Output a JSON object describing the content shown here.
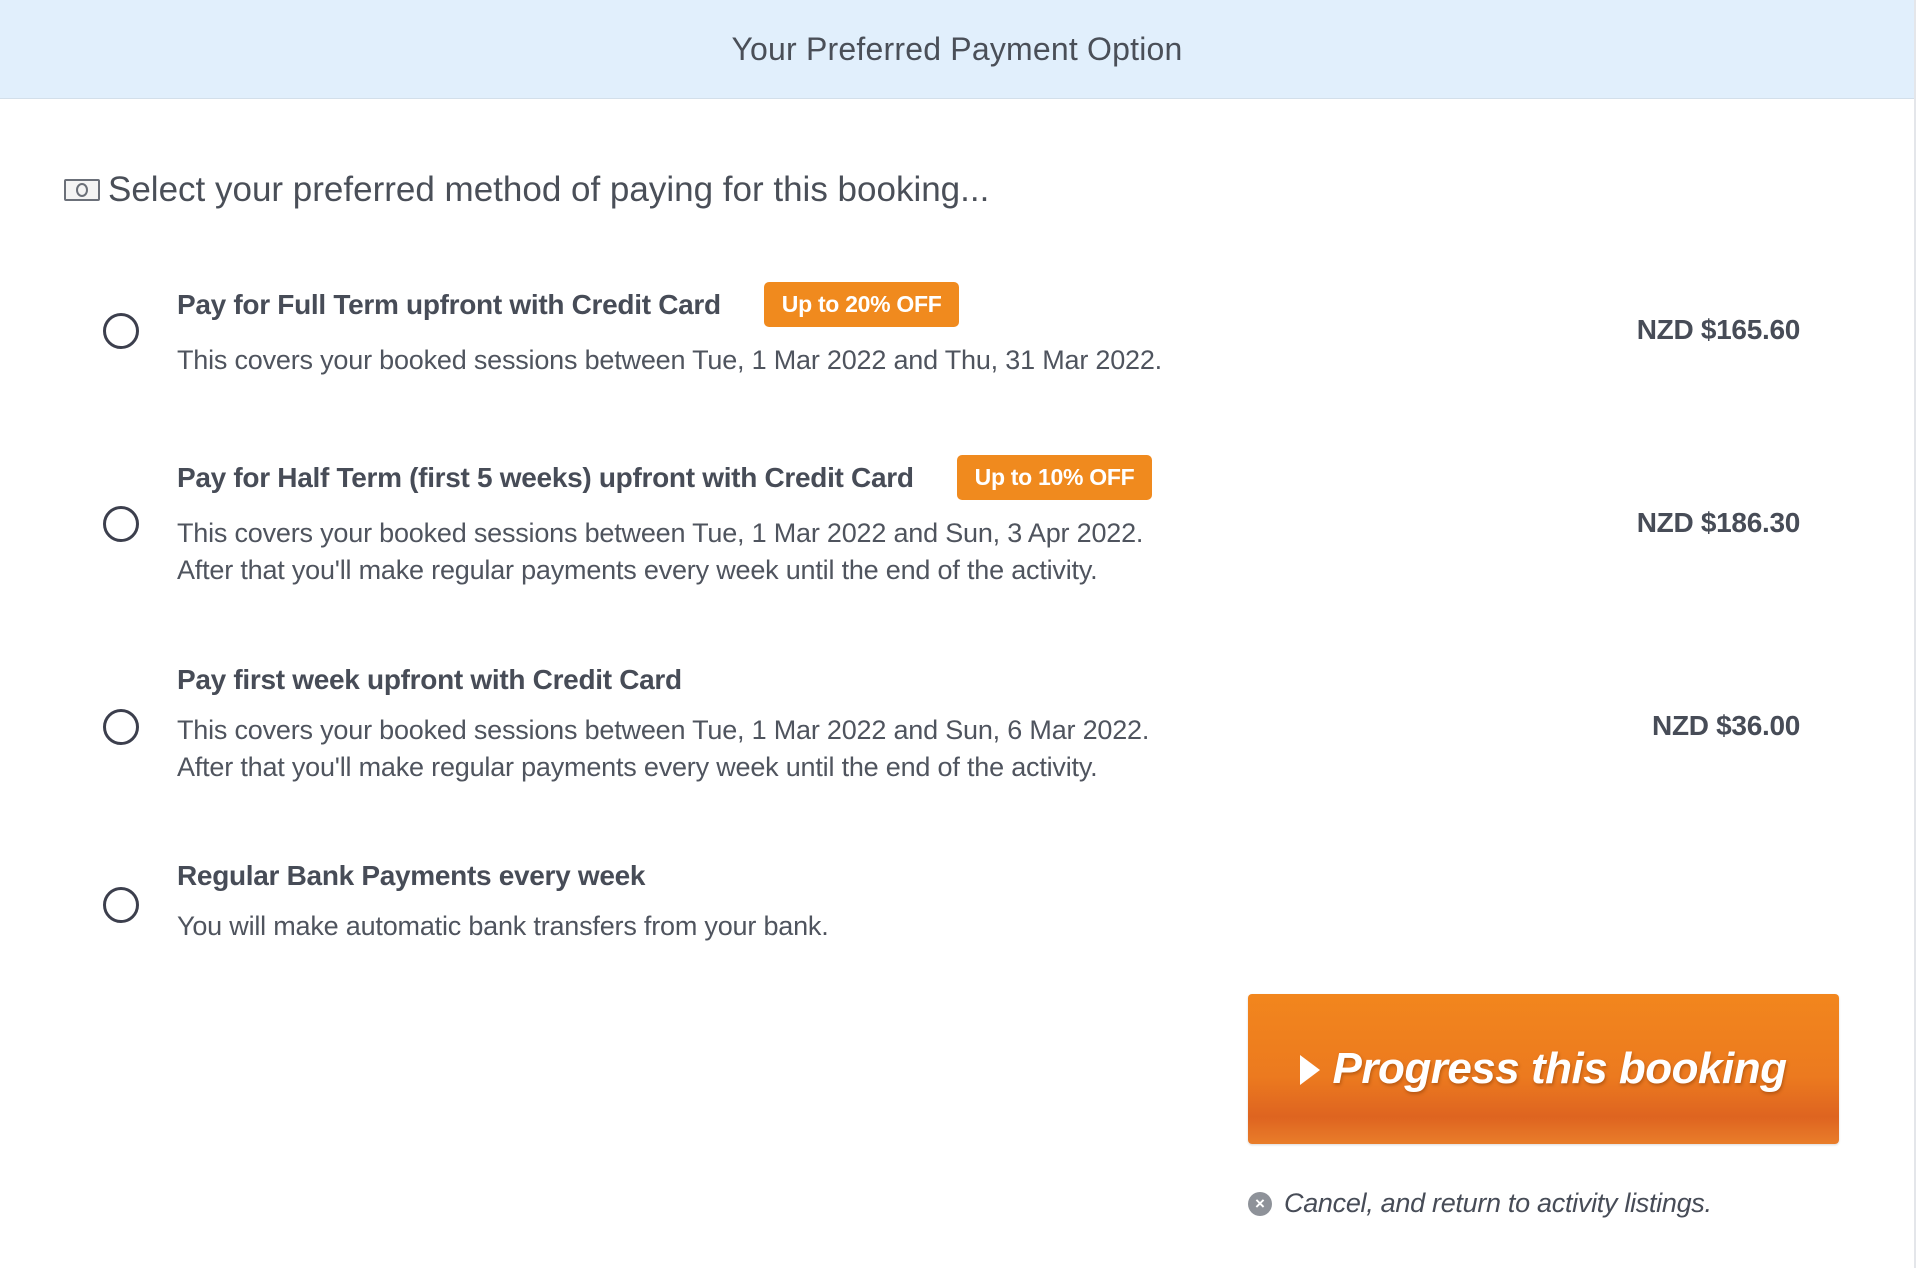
{
  "header": {
    "title": "Your Preferred Payment Option"
  },
  "intro": {
    "icon": "money-icon",
    "text": "Select your preferred method of paying for this booking..."
  },
  "options": [
    {
      "title": "Pay for Full Term upfront with Credit Card",
      "badge": "Up to 20% OFF",
      "desc_line1": "This covers your booked sessions between Tue, 1 Mar 2022 and Thu, 31 Mar 2022.",
      "desc_line2": "",
      "price": "NZD $165.60",
      "selected": false
    },
    {
      "title": "Pay for Half Term (first 5 weeks) upfront with Credit Card",
      "badge": "Up to 10% OFF",
      "desc_line1": "This covers your booked sessions between Tue, 1 Mar 2022 and Sun, 3 Apr 2022.",
      "desc_line2": "After that you'll make regular payments every week until the end of the activity.",
      "price": "NZD $186.30",
      "selected": false
    },
    {
      "title": "Pay first week upfront with Credit Card",
      "badge": "",
      "desc_line1": "This covers your booked sessions between Tue, 1 Mar 2022 and Sun, 6 Mar 2022.",
      "desc_line2": "After that you'll make regular payments every week until the end of the activity.",
      "price": "NZD $36.00",
      "selected": false
    },
    {
      "title": "Regular Bank Payments every week",
      "badge": "",
      "desc_line1": "You will make automatic bank transfers from your bank.",
      "desc_line2": "",
      "price": "",
      "selected": false
    }
  ],
  "actions": {
    "progress_label": "Progress this booking",
    "cancel_label": "Cancel, and return to activity listings."
  },
  "colors": {
    "header_bg": "#e1effc",
    "badge": "#f08a1e",
    "button": "#ec7a1f"
  }
}
